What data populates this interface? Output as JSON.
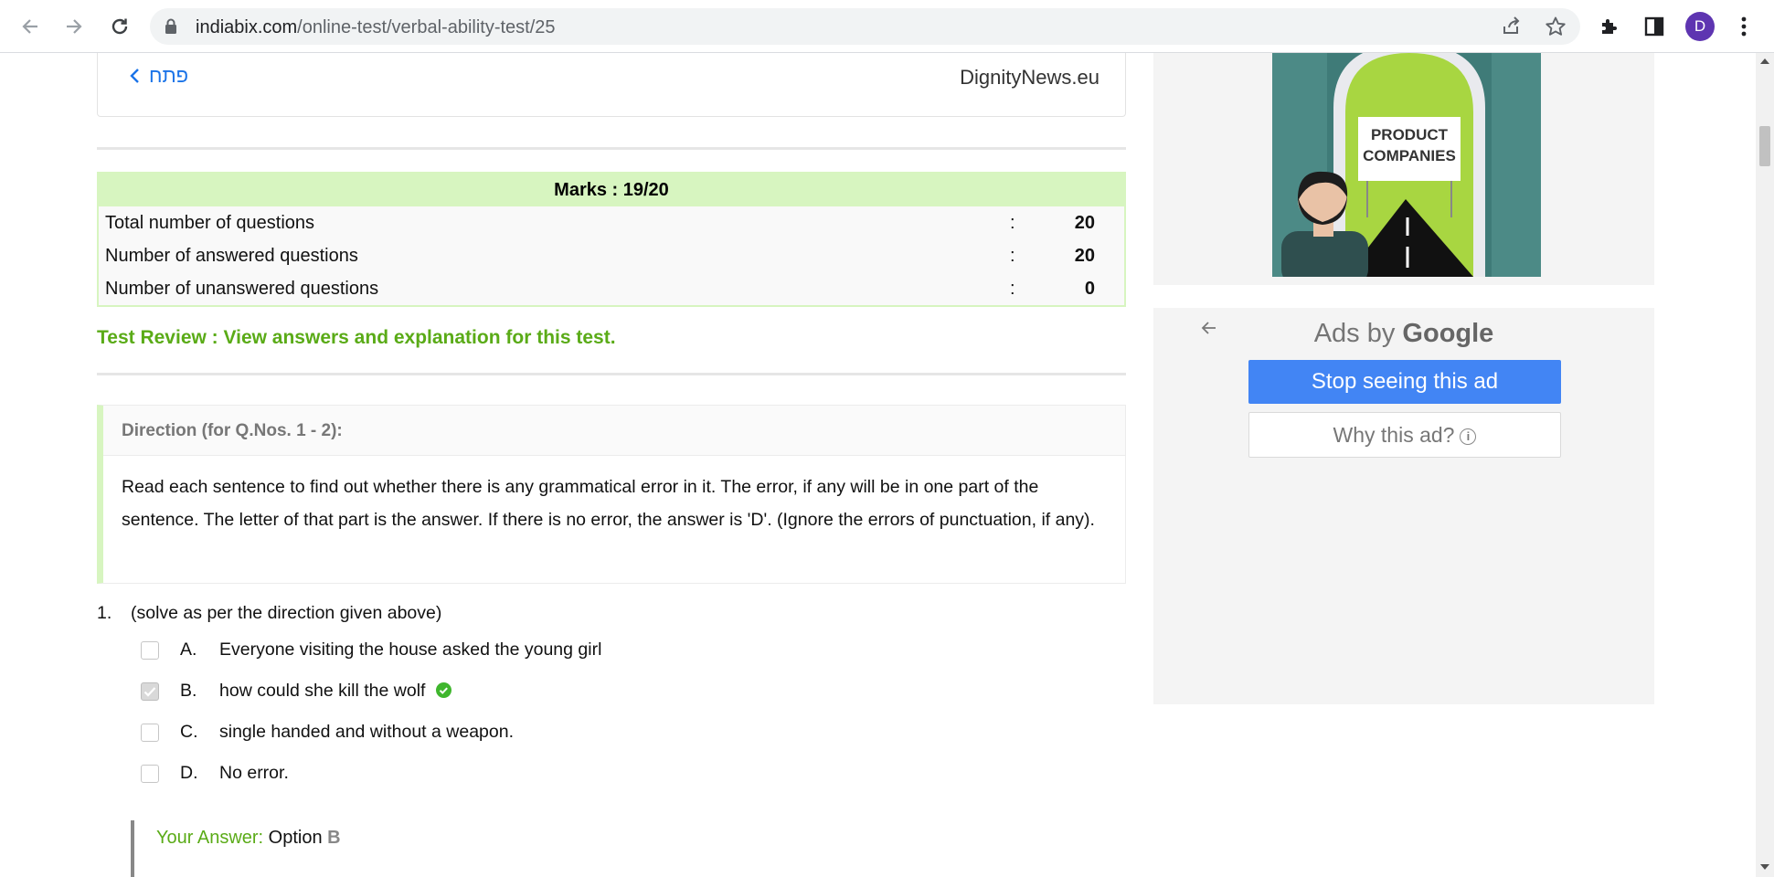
{
  "browser": {
    "url_host": "indiabix.com",
    "url_path": "/online-test/verbal-ability-test/25",
    "profile_initial": "D"
  },
  "top_ad": {
    "open_link": "פתח",
    "brand": "DignityNews.eu"
  },
  "marks": {
    "heading": "Marks : 19/20",
    "rows": [
      {
        "label": "Total number of questions",
        "value": "20"
      },
      {
        "label": "Number of answered questions",
        "value": "20"
      },
      {
        "label": "Number of unanswered questions",
        "value": "0"
      }
    ],
    "colon": ":"
  },
  "test_review": "Test Review : View answers and explanation for this test.",
  "direction": {
    "title": "Direction (for Q.Nos. 1 - 2):",
    "text": "Read each sentence to find out whether there is any grammatical error in it. The error, if any will be in one part of the sentence. The letter of that part is the answer. If there is no error, the answer is 'D'. (Ignore the errors of punctuation, if any)."
  },
  "question": {
    "number": "1.",
    "text": "(solve as per the direction given above)",
    "options": [
      {
        "letter": "A.",
        "text": "Everyone visiting the house asked the young girl",
        "checked": false,
        "correct": false
      },
      {
        "letter": "B.",
        "text": "how could she kill the wolf",
        "checked": true,
        "correct": true
      },
      {
        "letter": "C.",
        "text": "single handed and without a weapon.",
        "checked": false,
        "correct": false
      },
      {
        "letter": "D.",
        "text": "No error.",
        "checked": false,
        "correct": false
      }
    ]
  },
  "answer": {
    "label": "Your Answer:",
    "value": "Option",
    "option": "B"
  },
  "side_ad": {
    "image_text_1": "PRODUCT",
    "image_text_2": "COMPANIES",
    "ads_by": "Ads by",
    "google": "Google",
    "stop_button": "Stop seeing this ad",
    "why_button": "Why this ad?"
  },
  "colors": {
    "accent_green": "#5aab17",
    "marks_bg": "#d7f5c0",
    "link_blue": "#1a73e8",
    "ad_blue": "#4285f4"
  }
}
